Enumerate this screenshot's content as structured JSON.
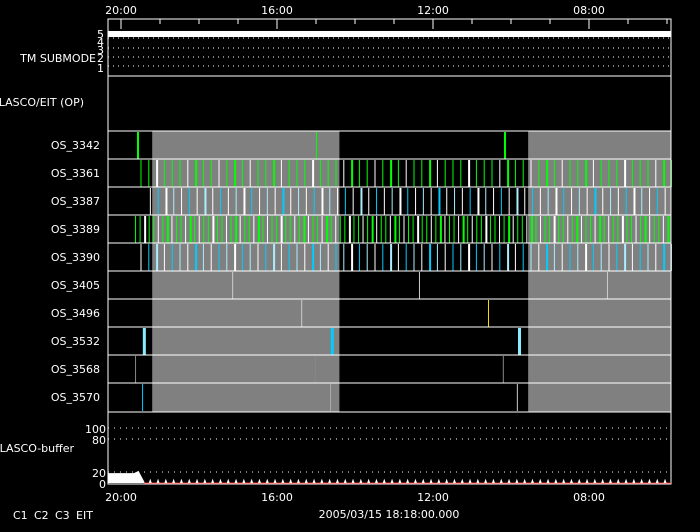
{
  "chart_data": {
    "type": "timeline",
    "title": "",
    "time_label": "2005/03/15 18:18:00.000",
    "x_axis": {
      "ticks": [
        "20:00",
        "16:00",
        "12:00",
        "08:00"
      ],
      "tick_hours_before_2000": [
        0,
        4,
        8,
        12
      ],
      "range_hours_before_2000": [
        -0.33,
        14.1
      ],
      "direction": "reversed"
    },
    "tm_submode": {
      "label": "TM SUBMODE",
      "ticks": [
        "5",
        "4",
        "3",
        "2",
        "1"
      ],
      "value": 5
    },
    "lasco_eit": {
      "label": "LASCO/EIT (OP)"
    },
    "gray_bands_hours": [
      [
        0.8,
        5.6
      ],
      [
        10.44,
        14.1
      ]
    ],
    "rows": [
      {
        "label": "OS_3342",
        "events": [
          {
            "h": 0.41,
            "c": "#00ff00",
            "w": 2
          },
          {
            "h": 5.0,
            "c": "#00ff00",
            "w": 1
          },
          {
            "h": 9.82,
            "c": "#00ff00",
            "w": 2
          }
        ]
      },
      {
        "label": "OS_3361",
        "dense": {
          "start": 0.5,
          "end": 14.1,
          "period_min": 12,
          "colors": [
            "#00ff00",
            "#00ff00",
            "#ffffff",
            "#00ff00"
          ]
        }
      },
      {
        "label": "OS_3387",
        "dense": {
          "start": 0.74,
          "end": 14.1,
          "period_min": 12,
          "colors": [
            "#ffffff",
            "#00ccff",
            "#ffffff",
            "#aaeeff"
          ]
        }
      },
      {
        "label": "OS_3389",
        "dense": {
          "start": 0.36,
          "end": 14.1,
          "period_min": 7,
          "colors": [
            "#00ff00",
            "#00ff00",
            "#ffffff"
          ]
        }
      },
      {
        "label": "OS_3390",
        "dense": {
          "start": 0.5,
          "end": 14.1,
          "period_min": 12,
          "colors": [
            "#ffffff",
            "#00ccff",
            "#aaeeff"
          ]
        }
      },
      {
        "label": "OS_3405",
        "events": [
          {
            "h": 2.85,
            "c": "#cccccc",
            "w": 1
          },
          {
            "h": 7.64,
            "c": "#cccccc",
            "w": 1
          },
          {
            "h": 12.46,
            "c": "#cccccc",
            "w": 1
          }
        ]
      },
      {
        "label": "OS_3496",
        "events": [
          {
            "h": 4.62,
            "c": "#cccccc",
            "w": 1
          },
          {
            "h": 9.41,
            "c": "#ffdd00",
            "w": 1
          }
        ]
      },
      {
        "label": "OS_3532",
        "events": [
          {
            "h": 0.56,
            "c": "#88eeff",
            "w": 3
          },
          {
            "h": 5.38,
            "c": "#00ccff",
            "w": 3
          },
          {
            "h": 10.18,
            "c": "#88eeff",
            "w": 3
          }
        ]
      },
      {
        "label": "OS_3568",
        "events": [
          {
            "h": 0.36,
            "c": "#888888",
            "w": 1
          },
          {
            "h": 4.97,
            "c": "#888888",
            "w": 1
          },
          {
            "h": 9.79,
            "c": "#888888",
            "w": 1
          }
        ]
      },
      {
        "label": "OS_3570",
        "events": [
          {
            "h": 0.54,
            "c": "#00ccff",
            "w": 1
          },
          {
            "h": 5.36,
            "c": "#aaaaaa",
            "w": 1
          },
          {
            "h": 10.15,
            "c": "#cccccc",
            "w": 1
          }
        ]
      }
    ],
    "buffer": {
      "label": "LASCO-buffer",
      "ticks": [
        "100",
        "80",
        "20",
        "0"
      ],
      "tick_values": [
        100,
        80,
        20,
        0
      ],
      "ylim": [
        0,
        100
      ],
      "initial_level": 18,
      "peak": 22,
      "spike_level": 8,
      "spike_period_min": 12
    },
    "legend": [
      {
        "name": "C1",
        "color": "#ff2020"
      },
      {
        "name": "C2",
        "color": "#00ff00"
      },
      {
        "name": "C3",
        "color": "#88ddff"
      },
      {
        "name": "EIT",
        "color": "#ffff00"
      }
    ]
  }
}
